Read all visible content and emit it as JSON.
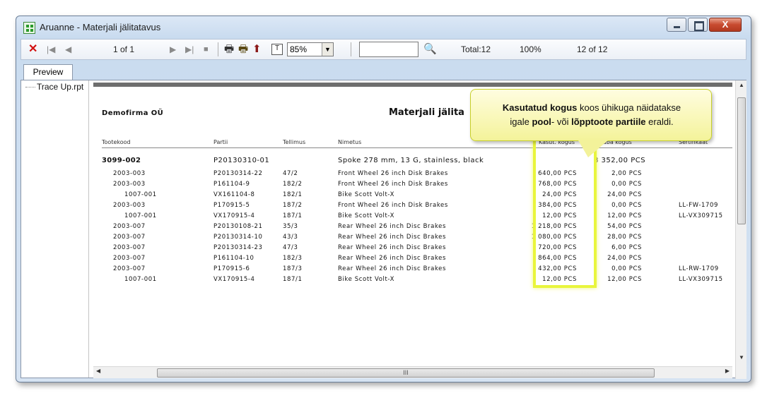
{
  "window": {
    "title": "Aruanne - Materjali jälitatavus",
    "close_label": "X"
  },
  "toolbar": {
    "close_glyph": "✕",
    "first_glyph": "|◀",
    "prev_glyph": "◀",
    "page_text": "1 of 1",
    "next_glyph": "▶",
    "last_glyph": "▶|",
    "stop_glyph": "■",
    "print_glyph": "🖶",
    "printsetup_glyph": "🖶",
    "export_glyph": "⬆",
    "tree_glyph": "T",
    "zoom": "85%",
    "zoom_arrow": "▼",
    "search_value": "",
    "find_glyph": "🔍",
    "total": "Total:12",
    "percent": "100%",
    "count": "12 of 12"
  },
  "tabs": {
    "preview": "Preview"
  },
  "tree": {
    "item": "Trace Up.rpt"
  },
  "report": {
    "company": "Demofirma OÜ",
    "title": "Materjali jälita",
    "headers": {
      "code": "Tootekood",
      "batch": "Partii",
      "order": "Tellimus",
      "name": "Nimetus",
      "used": "Kasut. kogus",
      "free": "Vaba kogus",
      "cert": "Sertifikaat"
    },
    "group": {
      "code": "3099-002",
      "batch": "P20130310-01",
      "name": "Spoke 278 mm, 13 G, stainless, black",
      "free": "8 352,00 PCS"
    },
    "rows": [
      {
        "code": "2003-003",
        "batch": "P20130314-22",
        "order": "47/2",
        "name": "Front Wheel 26 inch Disk Brakes",
        "used": "640,00 PCS",
        "free": "2,00 PCS",
        "cert": ""
      },
      {
        "code": "2003-003",
        "batch": "P161104-9",
        "order": "182/2",
        "name": "Front Wheel 26 inch Disk Brakes",
        "used": "768,00 PCS",
        "free": "0,00 PCS",
        "cert": ""
      },
      {
        "code": "1007-001",
        "batch": "VX161104-8",
        "order": "182/1",
        "name": "Bike Scott Volt-X",
        "used": "24,00 PCS",
        "free": "24,00 PCS",
        "cert": ""
      },
      {
        "code": "2003-003",
        "batch": "P170915-5",
        "order": "187/2",
        "name": "Front Wheel 26 inch Disk Brakes",
        "used": "384,00 PCS",
        "free": "0,00 PCS",
        "cert": "LL-FW-1709"
      },
      {
        "code": "1007-001",
        "batch": "VX170915-4",
        "order": "187/1",
        "name": "Bike Scott Volt-X",
        "used": "12,00 PCS",
        "free": "12,00 PCS",
        "cert": "LL-VX309715"
      },
      {
        "code": "2003-007",
        "batch": "P20130108-21",
        "order": "35/3",
        "name": "Rear Wheel 26 inch Disc Brakes",
        "used": "1 218,00 PCS",
        "free": "54,00 PCS",
        "cert": ""
      },
      {
        "code": "2003-007",
        "batch": "P20130314-10",
        "order": "43/3",
        "name": "Rear Wheel 26 inch Disc Brakes",
        "used": "1 080,00 PCS",
        "free": "28,00 PCS",
        "cert": ""
      },
      {
        "code": "2003-007",
        "batch": "P20130314-23",
        "order": "47/3",
        "name": "Rear Wheel 26 inch Disc Brakes",
        "used": "720,00 PCS",
        "free": "6,00 PCS",
        "cert": ""
      },
      {
        "code": "2003-007",
        "batch": "P161104-10",
        "order": "182/3",
        "name": "Rear Wheel 26 inch Disc Brakes",
        "used": "864,00 PCS",
        "free": "24,00 PCS",
        "cert": ""
      },
      {
        "code": "2003-007",
        "batch": "P170915-6",
        "order": "187/3",
        "name": "Rear Wheel 26 inch Disc Brakes",
        "used": "432,00 PCS",
        "free": "0,00 PCS",
        "cert": "LL-RW-1709"
      },
      {
        "code": "1007-001",
        "batch": "VX170915-4",
        "order": "187/1",
        "name": "Bike Scott Volt-X",
        "used": "12,00 PCS",
        "free": "12,00 PCS",
        "cert": "LL-VX309715"
      }
    ]
  },
  "callout": {
    "part1_bold": "Kasutatud kogus",
    "part2": " koos ühikuga näidatakse",
    "part3": "igale ",
    "part4_bold": "pool",
    "part5": "- või ",
    "part6_bold": "lõpptoote partiile",
    "part7": " eraldi."
  },
  "scrollbar": {
    "up": "▲",
    "down": "▼",
    "left": "◀",
    "right": "▶",
    "grip": "III"
  },
  "colors": {
    "highlight": "#e9f53c",
    "callout_bg": "#fffde0",
    "close_accent": "#d21010"
  }
}
